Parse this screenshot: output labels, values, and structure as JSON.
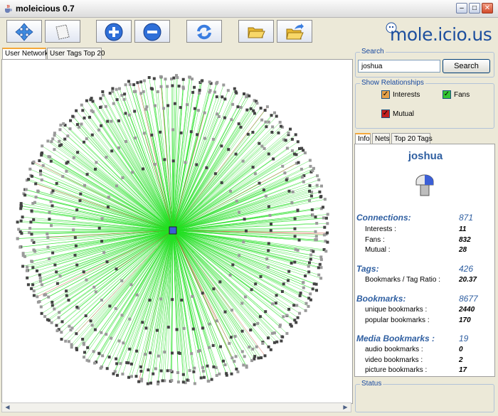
{
  "window": {
    "title": "moleicious 0.7"
  },
  "toolbar": {
    "buttons": [
      {
        "name": "move-tool-button",
        "icon": "move-arrows-icon"
      },
      {
        "name": "select-tool-button",
        "icon": "select-paper-icon"
      },
      {
        "name": "zoom-in-button",
        "icon": "plus-icon"
      },
      {
        "name": "zoom-out-button",
        "icon": "minus-icon"
      },
      {
        "name": "refresh-button",
        "icon": "refresh-icon"
      },
      {
        "name": "open-folder-button",
        "icon": "folder-open-icon"
      },
      {
        "name": "save-folder-button",
        "icon": "folder-export-icon"
      }
    ]
  },
  "logo": {
    "text": "mole.icio.us"
  },
  "left_tabs": [
    {
      "label": "User Network",
      "active": true
    },
    {
      "label": "User Tags Top 20",
      "active": false
    }
  ],
  "search": {
    "legend": "Search",
    "value": "joshua",
    "button_label": "Search"
  },
  "relationships": {
    "legend": "Show Relationships",
    "items": [
      {
        "label": "Interests",
        "checked": true,
        "color": "#e4a04a"
      },
      {
        "label": "Fans",
        "checked": true,
        "color": "#34c534"
      },
      {
        "label": "Mutual",
        "checked": true,
        "color": "#c42020"
      }
    ]
  },
  "info_tabs": [
    {
      "label": "Info",
      "active": true
    },
    {
      "label": "Nets",
      "active": false
    },
    {
      "label": "Top 20 Tags",
      "active": false
    }
  ],
  "info": {
    "username": "joshua",
    "connections": {
      "label": "Connections:",
      "value": "871",
      "rows": [
        {
          "label": "Interests :",
          "value": "11"
        },
        {
          "label": "Fans :",
          "value": "832"
        },
        {
          "label": "Mutual :",
          "value": "28"
        }
      ]
    },
    "tags": {
      "label": "Tags:",
      "value": "426",
      "rows": [
        {
          "label": "Bookmarks / Tag Ratio :",
          "value": "20.37"
        }
      ]
    },
    "bookmarks": {
      "label": "Bookmarks:",
      "value": "8677",
      "rows": [
        {
          "label": "unique bookmarks :",
          "value": "2440"
        },
        {
          "label": "popular bookmarks :",
          "value": "170"
        }
      ]
    },
    "media": {
      "label": "Media Bookmarks :",
      "value": "19",
      "rows": [
        {
          "label": "audio bookmarks :",
          "value": "0"
        },
        {
          "label": "video bookmarks :",
          "value": "2"
        },
        {
          "label": "picture bookmarks :",
          "value": "17"
        }
      ]
    }
  },
  "status": {
    "legend": "Status"
  },
  "colors": {
    "accent": "#2f5fa1",
    "fan_edge": "#22e022",
    "mutual_edge": "#c83a1a"
  }
}
